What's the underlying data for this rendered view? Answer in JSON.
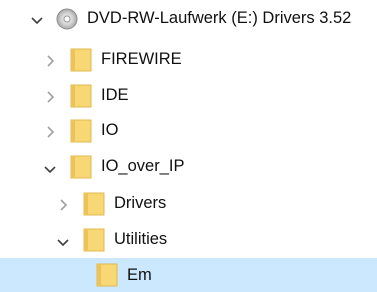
{
  "tree": {
    "nodes": [
      {
        "label": "DVD-RW-Laufwerk (E:) Drivers 3.52",
        "icon": "disc-drive-icon",
        "expanded": true,
        "level": 0
      },
      {
        "label": "FIREWIRE",
        "icon": "folder-icon",
        "expanded": false,
        "level": 1
      },
      {
        "label": "IDE",
        "icon": "folder-icon",
        "expanded": false,
        "level": 1
      },
      {
        "label": "IO",
        "icon": "folder-icon",
        "expanded": false,
        "level": 1
      },
      {
        "label": "IO_over_IP",
        "icon": "folder-icon",
        "expanded": true,
        "level": 1
      },
      {
        "label": "Drivers",
        "icon": "folder-icon",
        "expanded": false,
        "level": 2
      },
      {
        "label": "Utilities",
        "icon": "folder-icon",
        "expanded": true,
        "level": 2
      },
      {
        "label": "Em",
        "icon": "folder-icon",
        "expanded": null,
        "level": 3,
        "selected": true
      }
    ]
  },
  "colors": {
    "selection": "#cce8ff",
    "folder": "#f8d775",
    "folder_dark": "#e0b84d",
    "chevron_collapsed": "#a0a0a0",
    "chevron_expanded": "#404040"
  }
}
